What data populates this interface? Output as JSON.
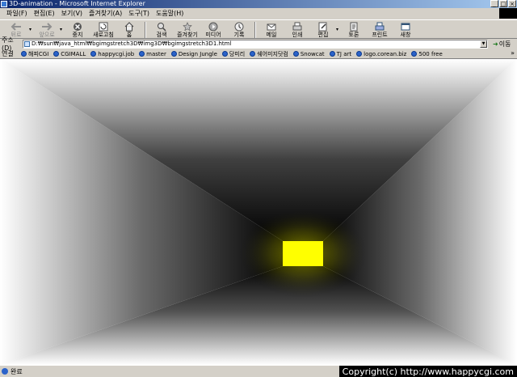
{
  "window": {
    "title": "3D-animation - Microsoft Internet Explorer",
    "controls": [
      "_",
      "□",
      "×"
    ]
  },
  "menu": [
    "파일(F)",
    "편집(E)",
    "보기(V)",
    "즐겨찾기(A)",
    "도구(T)",
    "도움말(H)"
  ],
  "toolbar": {
    "back": "뒤로",
    "forward": "앞으로",
    "stop": "중지",
    "refresh": "새로고침",
    "home": "홈",
    "search": "검색",
    "favorites": "즐겨찾기",
    "media": "미디어",
    "history": "기록",
    "mail": "메일",
    "print": "인쇄",
    "edit": "편집",
    "discuss": "토론",
    "print2": "프린트",
    "messenger": "새창"
  },
  "address": {
    "label": "주소(D)",
    "value": "D:₩sun₩java_html₩bgimgstretch3D₩img3D₩bgimgstretch3D1.html",
    "go": "이동"
  },
  "links": {
    "label": "연결",
    "items": [
      "해피CGI",
      "CGIMALL",
      "happycgi.job",
      "master",
      "Design Jungle",
      "당미리",
      "쉐어미지닷컴",
      "Snowcat",
      "TJ art",
      "logo.corean.biz",
      "500 free"
    ],
    "more": "»"
  },
  "status": {
    "text": "완료",
    "copyright": "Copyright(c) http://www.happycgi.com"
  },
  "colors": {
    "glow": "#ffff00",
    "corridor_dark": "#000000",
    "corridor_light": "#ffffff"
  }
}
